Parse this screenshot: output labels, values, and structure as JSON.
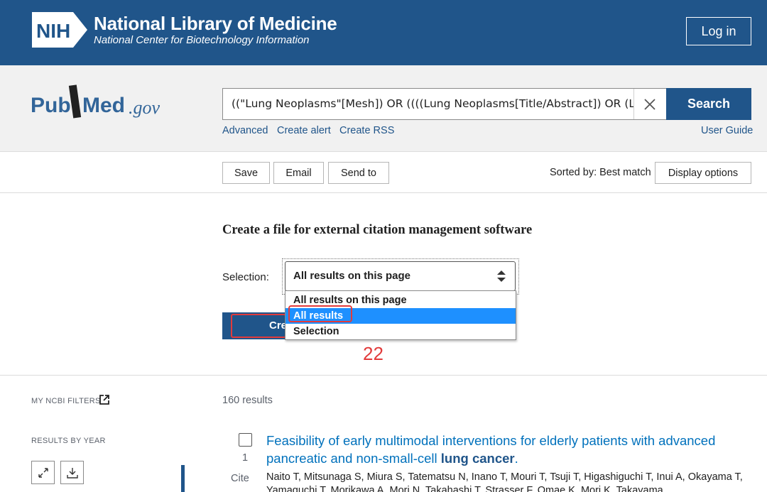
{
  "header": {
    "nih_logo_text": "NIH",
    "title": "National Library of Medicine",
    "subtitle": "National Center for Biotechnology Information",
    "login_label": "Log in"
  },
  "search": {
    "logo_text_pub": "Pub",
    "logo_text_med": "Med",
    "logo_text_gov": ".gov",
    "query": "((\"Lung Neoplasms\"[Mesh]) OR ((((Lung Neoplasms[Title/Abstract]) OR (Lung",
    "button_label": "Search",
    "links": [
      "Advanced",
      "Create alert",
      "Create RSS"
    ],
    "user_guide": "User Guide"
  },
  "actions": {
    "save": "Save",
    "email": "Email",
    "send_to": "Send to",
    "sorted_by": "Sorted by: Best match",
    "display_options": "Display options"
  },
  "citation": {
    "heading": "Create a file for external citation management software",
    "selection_label": "Selection:",
    "selected_value": "All results on this page",
    "options": [
      "All results on this page",
      "All results",
      "Selection"
    ],
    "highlighted_option": "All results",
    "create_button": "Create file",
    "create_visible": "Cre",
    "annotation_number": "22"
  },
  "sidebar": {
    "my_ncbi_filters": "MY NCBI FILTERS",
    "results_by_year": "RESULTS BY YEAR"
  },
  "results": {
    "count": "160 results",
    "items": [
      {
        "number": "1",
        "cite": "Cite",
        "title_prefix": "Feasibility of early multimodal interventions for elderly patients with advanced pancreatic and non-small-cell ",
        "title_highlight": "lung cancer",
        "title_suffix": ".",
        "authors": "Naito T, Mitsunaga S, Miura S, Tatematsu N, Inano T, Mouri T, Tsuji T, Higashiguchi T, Inui A, Okayama T,",
        "authors_line2": "Yamaguchi T, Morikawa A, Mori N, Takahashi T, Strasser F, Omae K, Mori K, Takayama K."
      }
    ]
  },
  "colors": {
    "nih_blue": "#20558a",
    "link_blue": "#0071bc",
    "dropdown_highlight": "#1e90ff",
    "annotation_red": "#e23b3b"
  }
}
